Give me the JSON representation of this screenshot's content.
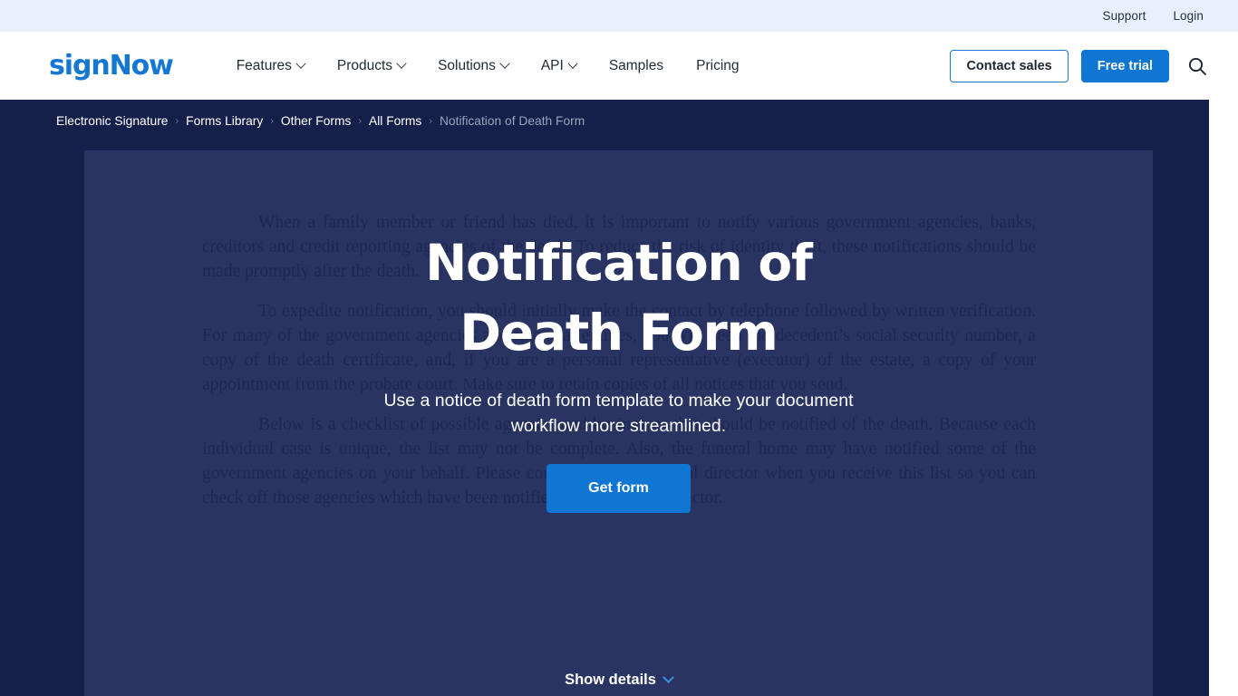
{
  "topbar": {
    "links": [
      {
        "label": "Support"
      },
      {
        "label": "Login"
      }
    ]
  },
  "header": {
    "logo": "signNow",
    "nav": [
      {
        "label": "Features",
        "has_dropdown": true
      },
      {
        "label": "Products",
        "has_dropdown": true
      },
      {
        "label": "Solutions",
        "has_dropdown": true
      },
      {
        "label": "API",
        "has_dropdown": true
      },
      {
        "label": "Samples",
        "has_dropdown": false
      },
      {
        "label": "Pricing",
        "has_dropdown": false
      }
    ],
    "contact_sales_label": "Contact sales",
    "free_trial_label": "Free trial",
    "search_icon": "search-icon"
  },
  "breadcrumb": {
    "separator": "›",
    "items": [
      {
        "label": "Electronic Signature",
        "current": false
      },
      {
        "label": "Forms Library",
        "current": false
      },
      {
        "label": "Other Forms",
        "current": false
      },
      {
        "label": "All Forms",
        "current": false
      },
      {
        "label": "Notification of Death Form",
        "current": true
      }
    ]
  },
  "hero": {
    "title": "Notification of Death Form",
    "subtitle": "Use a notice of death form template to make your document workflow more streamlined.",
    "cta_label": "Get form",
    "show_details_label": "Show details",
    "show_details_icon": "chevron-down-icon",
    "background_document": {
      "paragraphs": [
        "When a family member or friend has died, it is important to notify various government agencies, banks, creditors and credit reporting agencies of the death.  To reduce the risk of identity theft, these notifications should be made promptly after the death.",
        "To expedite notification, you should initially make the contact by telephone followed by written verification.  For many of the government agencies and financial entities, you will need the decedent’s social security number, a copy of the death certificate, and, if you are a personal representative (executor) of the estate, a copy of your appointment from the probate court.  Make sure to retain copies of all notices that you send.",
        "Below is a checklist of possible agencies and businesses that should be notified of the death.  Because each individual case is unique, the list may not be complete.  Also, the funeral home may have notified some of the government agencies on your behalf.  Please consult with the funeral director when you receive this list so you can check off those agencies which have been notified by the funeral director."
      ]
    }
  },
  "colors": {
    "brand_blue": "#1076d4",
    "logo_blue": "#1477d4",
    "topbar_bg": "#e9effb",
    "hero_outer_bg": "#15204a",
    "hero_card_bg": "#2a3462",
    "breadcrumb_current": "#9aa3bd",
    "doc_text": "#1c2751"
  }
}
